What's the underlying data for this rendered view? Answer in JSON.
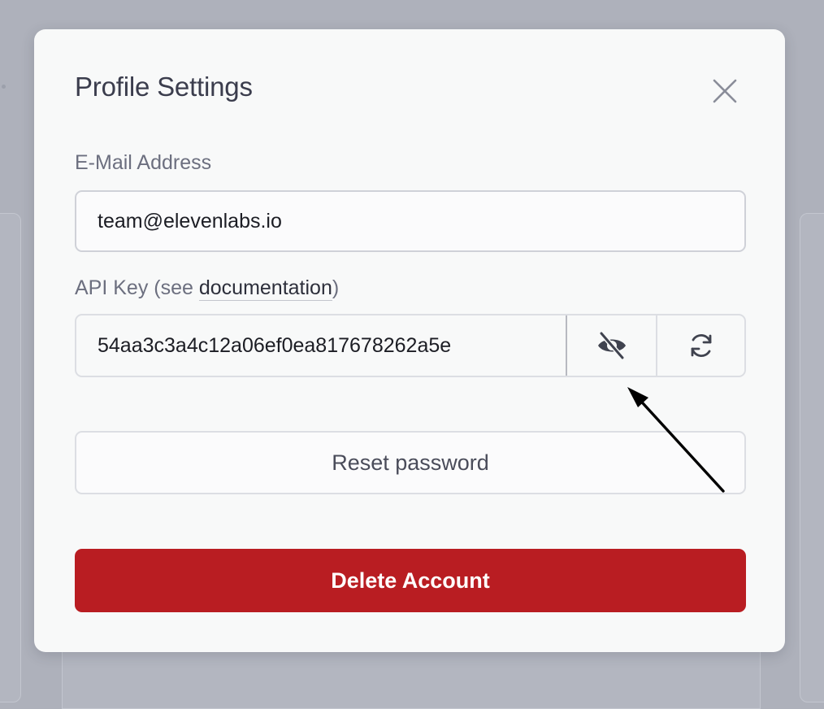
{
  "modal": {
    "title": "Profile Settings"
  },
  "email": {
    "label": "E-Mail Address",
    "value": "team@elevenlabs.io"
  },
  "api_key": {
    "label_prefix": "API Key (see ",
    "link_text": "documentation",
    "label_suffix": ")",
    "value": "54aa3c3a4c12a06ef0ea817678262a5e",
    "toggle_visibility_icon": "eye-slash-icon",
    "regenerate_icon": "refresh-icon"
  },
  "actions": {
    "reset_password_label": "Reset password",
    "delete_account_label": "Delete Account"
  },
  "colors": {
    "danger": "#b91d22",
    "overlay": "#aeb1bb",
    "modal_bg": "#f8f9f9"
  }
}
